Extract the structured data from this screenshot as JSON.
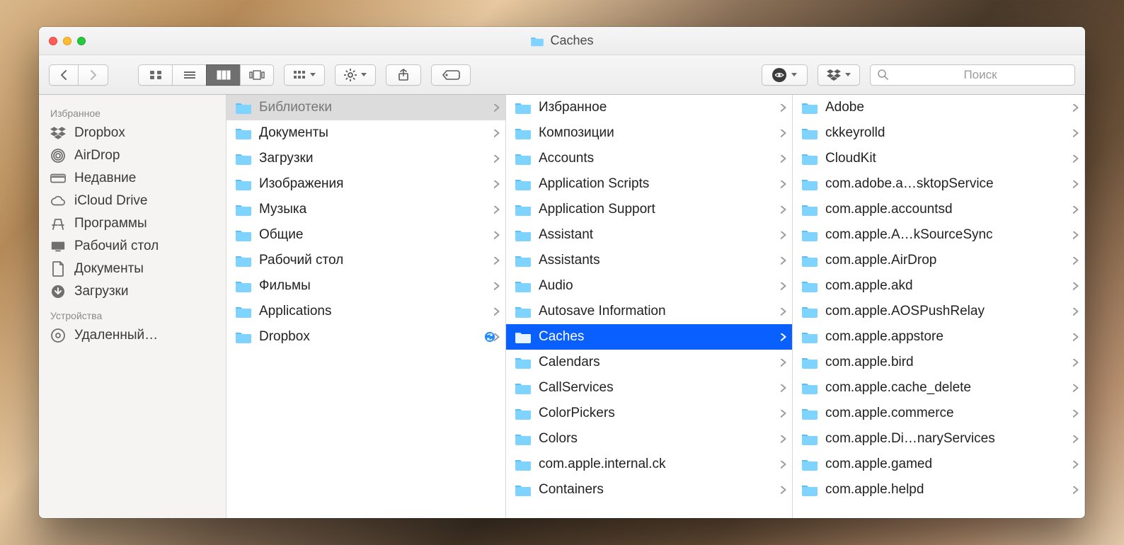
{
  "window": {
    "title": "Caches"
  },
  "search": {
    "placeholder": "Поиск"
  },
  "sidebar": {
    "sections": [
      {
        "header": "Избранное",
        "items": [
          {
            "icon": "dropbox",
            "label": "Dropbox"
          },
          {
            "icon": "airdrop",
            "label": "AirDrop"
          },
          {
            "icon": "recents",
            "label": "Недавние"
          },
          {
            "icon": "icloud",
            "label": "iCloud Drive"
          },
          {
            "icon": "apps",
            "label": "Программы"
          },
          {
            "icon": "desktop",
            "label": "Рабочий стол"
          },
          {
            "icon": "docs",
            "label": "Документы"
          },
          {
            "icon": "downloads",
            "label": "Загрузки"
          }
        ]
      },
      {
        "header": "Устройства",
        "items": [
          {
            "icon": "remote",
            "label": "Удаленный…"
          }
        ]
      }
    ]
  },
  "columns": [
    {
      "items": [
        {
          "label": "Библиотеки",
          "icon": "folder",
          "selected": "grey"
        },
        {
          "label": "Документы",
          "icon": "folder"
        },
        {
          "label": "Загрузки",
          "icon": "folder"
        },
        {
          "label": "Изображения",
          "icon": "folder"
        },
        {
          "label": "Музыка",
          "icon": "folder"
        },
        {
          "label": "Общие",
          "icon": "folder"
        },
        {
          "label": "Рабочий стол",
          "icon": "folder"
        },
        {
          "label": "Фильмы",
          "icon": "folder"
        },
        {
          "label": "Applications",
          "icon": "folder"
        },
        {
          "label": "Dropbox",
          "icon": "folder",
          "sync": true
        }
      ]
    },
    {
      "items": [
        {
          "label": "Избранное",
          "icon": "folder"
        },
        {
          "label": "Композиции",
          "icon": "folder"
        },
        {
          "label": "Accounts",
          "icon": "folder"
        },
        {
          "label": "Application Scripts",
          "icon": "folder"
        },
        {
          "label": "Application Support",
          "icon": "folder"
        },
        {
          "label": "Assistant",
          "icon": "folder"
        },
        {
          "label": "Assistants",
          "icon": "folder"
        },
        {
          "label": "Audio",
          "icon": "folder"
        },
        {
          "label": "Autosave Information",
          "icon": "folder"
        },
        {
          "label": "Caches",
          "icon": "folder",
          "selected": "blue"
        },
        {
          "label": "Calendars",
          "icon": "folder"
        },
        {
          "label": "CallServices",
          "icon": "folder"
        },
        {
          "label": "ColorPickers",
          "icon": "folder"
        },
        {
          "label": "Colors",
          "icon": "folder"
        },
        {
          "label": "com.apple.internal.ck",
          "icon": "folder"
        },
        {
          "label": "Containers",
          "icon": "folder"
        }
      ]
    },
    {
      "items": [
        {
          "label": "Adobe",
          "icon": "folder"
        },
        {
          "label": "ckkeyrolld",
          "icon": "folder"
        },
        {
          "label": "CloudKit",
          "icon": "folder"
        },
        {
          "label": "com.adobe.a…sktopService",
          "icon": "folder"
        },
        {
          "label": "com.apple.accountsd",
          "icon": "folder"
        },
        {
          "label": "com.apple.A…kSourceSync",
          "icon": "folder"
        },
        {
          "label": "com.apple.AirDrop",
          "icon": "folder"
        },
        {
          "label": "com.apple.akd",
          "icon": "folder"
        },
        {
          "label": "com.apple.AOSPushRelay",
          "icon": "folder"
        },
        {
          "label": "com.apple.appstore",
          "icon": "folder"
        },
        {
          "label": "com.apple.bird",
          "icon": "folder"
        },
        {
          "label": "com.apple.cache_delete",
          "icon": "folder"
        },
        {
          "label": "com.apple.commerce",
          "icon": "folder"
        },
        {
          "label": "com.apple.Di…naryServices",
          "icon": "folder"
        },
        {
          "label": "com.apple.gamed",
          "icon": "folder"
        },
        {
          "label": "com.apple.helpd",
          "icon": "folder"
        }
      ]
    }
  ]
}
